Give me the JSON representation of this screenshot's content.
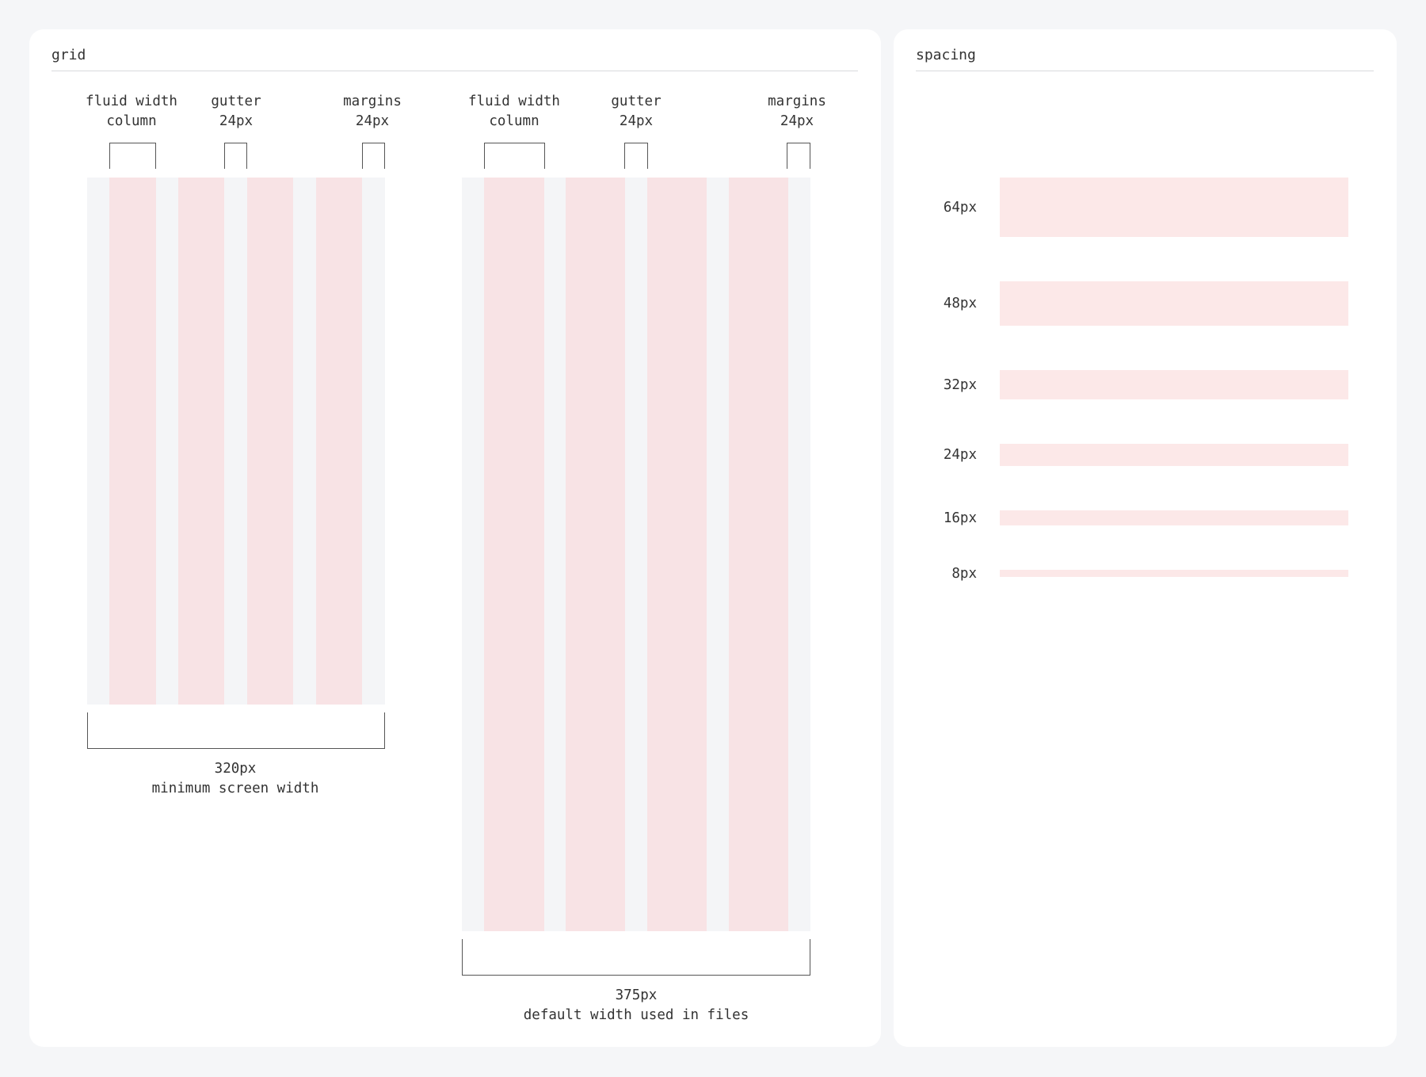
{
  "grid_panel": {
    "title": "grid",
    "small_grid": {
      "column_label": [
        "fluid width",
        "column"
      ],
      "gutter_label": [
        "gutter",
        "24px"
      ],
      "margins_label": [
        "margins",
        "24px"
      ],
      "width_label": "320px",
      "width_caption": "minimum screen width"
    },
    "large_grid": {
      "column_label": [
        "fluid width",
        "column"
      ],
      "gutter_label": [
        "gutter",
        "24px"
      ],
      "margins_label": [
        "margins",
        "24px"
      ],
      "width_label": "375px",
      "width_caption": "default width used in files"
    },
    "colors": {
      "column": "#f8e3e5",
      "margin": "#f4f5f7"
    }
  },
  "spacing_panel": {
    "title": "spacing",
    "items": [
      {
        "label": "64px",
        "value": 64
      },
      {
        "label": "48px",
        "value": 48
      },
      {
        "label": "32px",
        "value": 32
      },
      {
        "label": "24px",
        "value": 24
      },
      {
        "label": "16px",
        "value": 16
      },
      {
        "label": "8px",
        "value": 8
      }
    ],
    "colors": {
      "bar": "#fce8e8"
    }
  }
}
